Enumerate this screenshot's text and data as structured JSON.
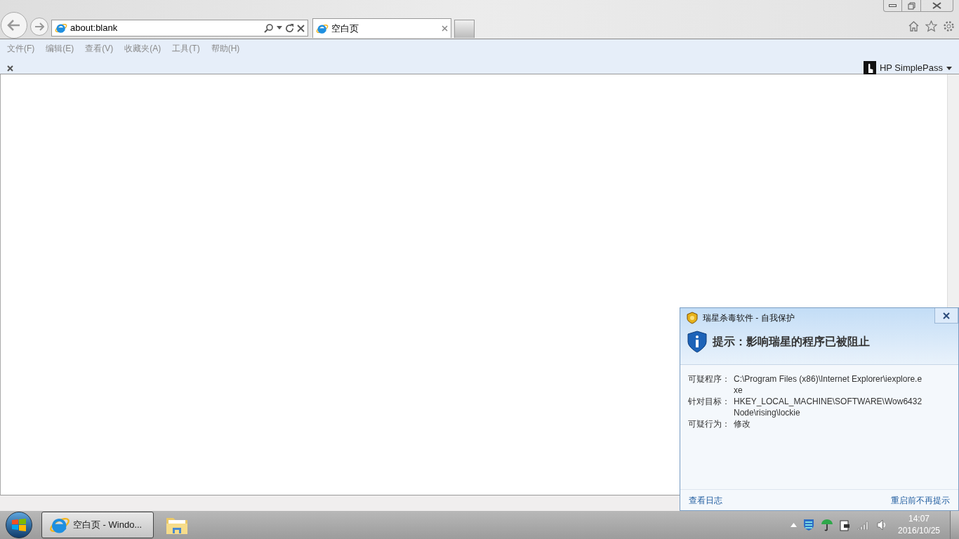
{
  "browser": {
    "address": "about:blank",
    "tabs": [
      {
        "label": "空白页",
        "selected": true
      }
    ],
    "menu": [
      "文件(F)",
      "编辑(E)",
      "查看(V)",
      "收藏夹(A)",
      "工具(T)",
      "帮助(H)"
    ],
    "addon": "HP SimplePass"
  },
  "dialog": {
    "title": "瑞星杀毒软件 - 自我保护",
    "heading": "提示：影响瑞星的程序已被阻止",
    "rows": [
      {
        "label": "可疑程序：",
        "value": "C:\\Program Files (x86)\\Internet Explorer\\iexplore.exe"
      },
      {
        "label": "针对目标：",
        "value": "HKEY_LOCAL_MACHINE\\SOFTWARE\\Wow6432Node\\rising\\lockie"
      },
      {
        "label": "可疑行为：",
        "value": "修改"
      }
    ],
    "links": [
      "查看日志",
      "重启前不再提示"
    ]
  },
  "taskbar": {
    "tasks": [
      {
        "kind": "ie",
        "label": "空白页 - Windo...",
        "selected": true
      },
      {
        "kind": "folder",
        "selected": false
      }
    ],
    "time": "14:07",
    "date": "2016/10/25"
  }
}
